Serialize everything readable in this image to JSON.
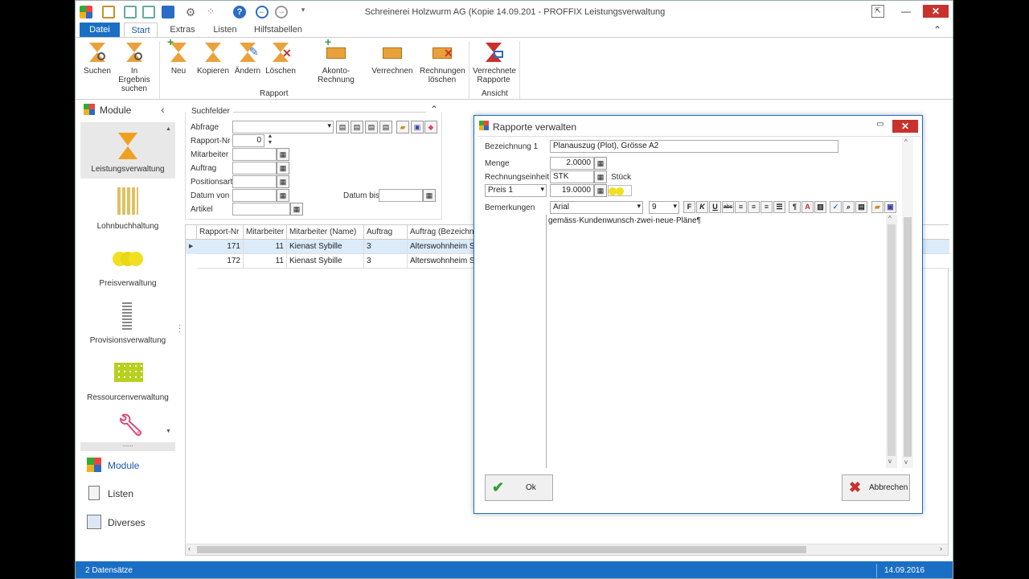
{
  "window": {
    "title": "Schreinerei Holzwurm AG (Kopie 14.09.201 - PROFFIX Leistungsverwaltung"
  },
  "ribbon": {
    "tabs": [
      "Datei",
      "Start",
      "Extras",
      "Listen",
      "Hilfstabellen"
    ],
    "buttons": {
      "suchen": "Suchen",
      "in_ergebnis_1": "In Ergebnis",
      "in_ergebnis_2": "suchen",
      "neu": "Neu",
      "kopieren": "Kopieren",
      "aendern": "Ändern",
      "loeschen": "Löschen",
      "akonto": "Akonto-Rechnung",
      "verrechnen": "Verrechnen",
      "rechnungen_1": "Rechnungen",
      "rechnungen_2": "löschen",
      "verrechnete_1": "Verrechnete",
      "verrechnete_2": "Rapporte"
    },
    "groups": {
      "rapport": "Rapport",
      "ansicht": "Ansicht"
    }
  },
  "sidebar": {
    "header": "Module",
    "modules": [
      "Leistungsverwaltung",
      "Lohnbuchhaltung",
      "Preisverwaltung",
      "Provisionsverwaltung",
      "Ressourcenverwaltung"
    ],
    "nav": [
      "Module",
      "Listen",
      "Diverses"
    ]
  },
  "search": {
    "title": "Suchfelder",
    "labels": {
      "abfrage": "Abfrage",
      "rapport_nr": "Rapport-Nr",
      "mitarbeiter": "Mitarbeiter",
      "auftrag": "Auftrag",
      "positionsart": "Positionsart",
      "datum_von": "Datum von",
      "datum_bis": "Datum bis",
      "artikel": "Artikel"
    },
    "rapport_nr_value": "0"
  },
  "grid": {
    "columns": [
      "Rapport-Nr",
      "Mitarbeiter",
      "Mitarbeiter (Name)",
      "Auftrag",
      "Auftrag (Bezeichnu"
    ],
    "rows": [
      [
        "171",
        "11",
        "Kienast Sybille",
        "3",
        "Alterswohnheim Son"
      ],
      [
        "172",
        "11",
        "Kienast Sybille",
        "3",
        "Alterswohnheim Son"
      ]
    ]
  },
  "status": {
    "left": "2 Datensätze",
    "date": "14.09.2016"
  },
  "dialog": {
    "title": "Rapporte verwalten",
    "labels": {
      "bezeichnung": "Bezeichnung 1",
      "menge": "Menge",
      "einheit": "Rechnungseinheit",
      "bemerkungen": "Bemerkungen"
    },
    "bezeichnung_value": "Planauszug (Plot), Grösse A2",
    "menge_value": "2.0000",
    "einheit_value": "STK",
    "einheit_text": "Stück",
    "preis_select": "Preis 1",
    "preis_value": "19.0000",
    "font_name": "Arial",
    "font_size": "9",
    "format_buttons": {
      "bold": "F",
      "italic": "K",
      "underline": "U",
      "strike": "abc",
      "para": "¶",
      "color": "A"
    },
    "remark_text": "gemäss·Kundenwunsch·zwei·neue·Pläne¶",
    "ok": "Ok",
    "cancel": "Abbrechen"
  }
}
